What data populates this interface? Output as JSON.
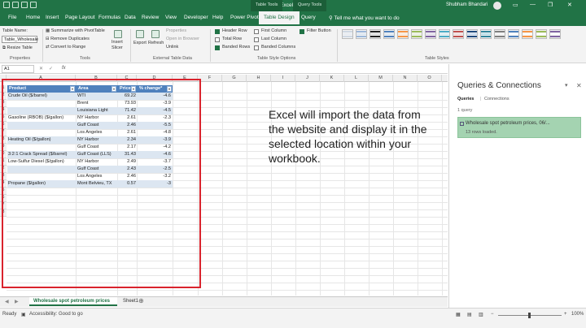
{
  "titlebar": {
    "title": "Book1 - Excel",
    "context_table_tools": "Table Tools",
    "context_query_tools": "Query Tools",
    "user": "Shubham Bhandari"
  },
  "tabs": [
    "File",
    "Home",
    "Insert",
    "Page Layout",
    "Formulas",
    "Data",
    "Review",
    "View",
    "Developer",
    "Help",
    "Power Pivot",
    "Table Design",
    "Query"
  ],
  "active_tab": "Table Design",
  "tell_me": "Tell me what you want to do",
  "ribbon": {
    "properties": {
      "table_name_label": "Table Name:",
      "table_name_value": "Table_Wholesale",
      "resize": "Resize Table",
      "group": "Properties"
    },
    "tools": {
      "summarize": "Summarize with PivotTable",
      "remove_dup": "Remove Duplicates",
      "convert": "Convert to Range",
      "insert_slicer": "Insert Slicer",
      "group": "Tools"
    },
    "external": {
      "export": "Export",
      "refresh": "Refresh",
      "properties": "Properties",
      "open_browser": "Open in Browser",
      "unlink": "Unlink",
      "group": "External Table Data"
    },
    "style_options": {
      "header_row": "Header Row",
      "total_row": "Total Row",
      "banded_rows": "Banded Rows",
      "first_column": "First Column",
      "last_column": "Last Column",
      "banded_columns": "Banded Columns",
      "filter_button": "Filter Button",
      "group": "Table Style Options"
    },
    "styles_group": "Table Styles"
  },
  "formula_bar": {
    "name_box": "A1",
    "fx": "fx"
  },
  "columns": [
    "A",
    "B",
    "C",
    "D",
    "E",
    "F",
    "G",
    "H",
    "I",
    "J",
    "K",
    "L",
    "M",
    "N",
    "O",
    "P"
  ],
  "rows": [
    "1",
    "2",
    "3",
    "4",
    "5",
    "6",
    "7",
    "8",
    "9",
    "0",
    "1",
    "2",
    "3",
    "4",
    "5",
    "6",
    "7",
    "8"
  ],
  "table": {
    "headers": [
      "Product",
      "Area",
      "Price",
      "% change*"
    ],
    "rows": [
      [
        "Crude Oil ($/barrel)",
        "WTI",
        "69.22",
        "-4.6"
      ],
      [
        "",
        "Brent",
        "73.93",
        "-3.9"
      ],
      [
        "",
        "Louisiana Light",
        "71.42",
        "-4.5"
      ],
      [
        "Gasoline (RBOB) ($/gallon)",
        "NY Harbor",
        "2.61",
        "-2.3"
      ],
      [
        "",
        "Gulf Coast",
        "2.46",
        "-5.5"
      ],
      [
        "",
        "Los Angeles",
        "2.61",
        "-4.8"
      ],
      [
        "Heating Oil ($/gallon)",
        "NY Harbor",
        "2.34",
        "-3.9"
      ],
      [
        "",
        "Gulf Coast",
        "2.17",
        "-4.2"
      ],
      [
        "3:2:1 Crack Spread ($/barrel)",
        "Gulf Coast (LLS)",
        "31.43",
        "-4.6"
      ],
      [
        "Low-Sulfur Diesel ($/gallon)",
        "NY Harbor",
        "2.49",
        "-3.7"
      ],
      [
        "",
        "Gulf Coast",
        "2.43",
        "-2.5"
      ],
      [
        "",
        "Los Angeles",
        "2.46",
        "-3.2"
      ],
      [
        "Propane ($/gallon)",
        "Mont Belvieu, TX",
        "0.57",
        "-3"
      ]
    ]
  },
  "overlay_text": "Excel will import the data from the website and display it in the selected location within your workbook.",
  "sheets": [
    "Wholesale spot petroleum prices",
    "Sheet1"
  ],
  "status": {
    "ready": "Ready",
    "accessibility": "Accessibility: Good to go",
    "zoom": "100%"
  },
  "pane": {
    "title": "Queries & Connections",
    "tab_queries": "Queries",
    "tab_connections": "Connections",
    "count": "1 query",
    "query_name": "Wholesale spot petroleum prices, 06/...",
    "query_rows": "13 rows loaded."
  },
  "colors": {
    "excel_green": "#217346",
    "table_header": "#4f81bd",
    "table_band": "#dce6f1",
    "highlight_border": "#d9232d",
    "query_card": "#a4d3b1"
  }
}
